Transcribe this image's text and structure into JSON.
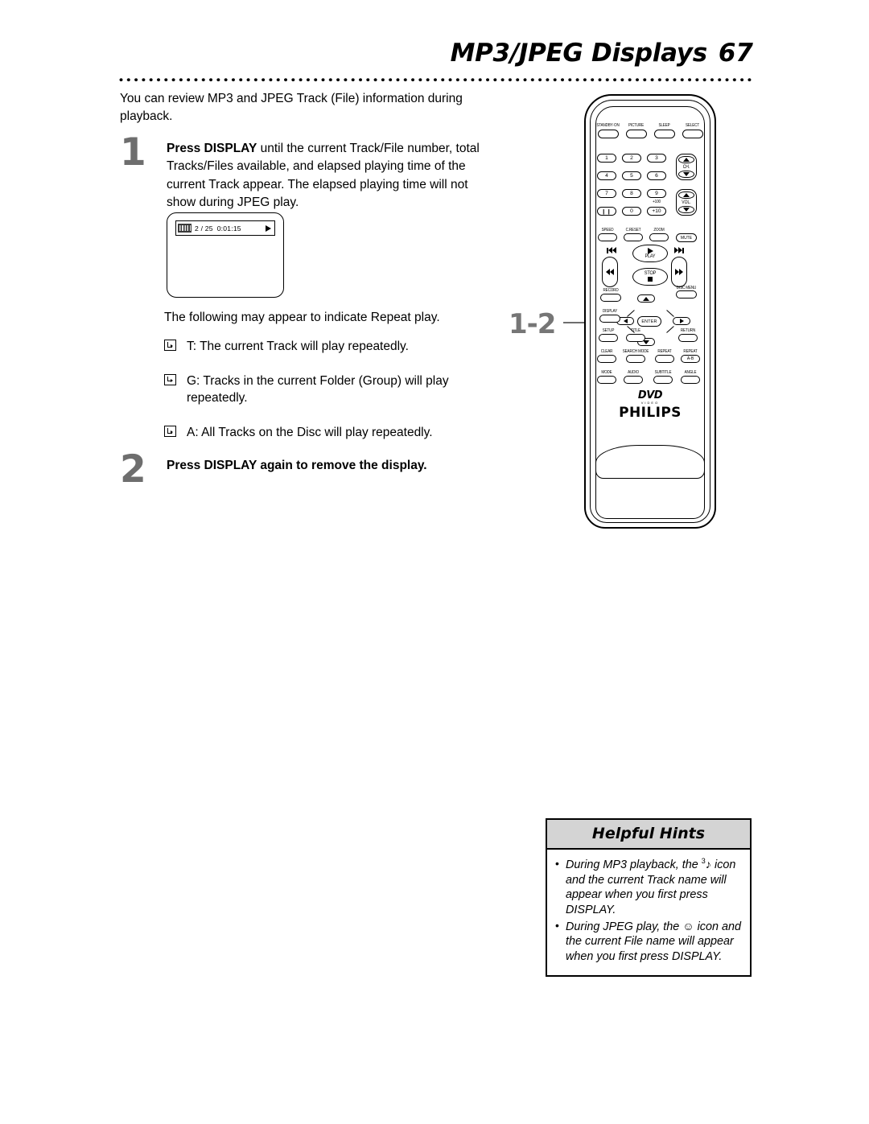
{
  "header": {
    "title": "MP3/JPEG Displays",
    "page_number": "67"
  },
  "intro": "You can review MP3 and  JPEG Track (File) information during playback.",
  "steps": [
    {
      "number": "1",
      "bold_lead": "Press DISPLAY",
      "rest": " until the current Track/File number, total Tracks/Files available, and elapsed playing time of the current Track appear. The elapsed playing time will not show during JPEG play."
    },
    {
      "number": "2",
      "text": "Press DISPLAY again to remove the display."
    }
  ],
  "osd": {
    "icon": "mp3-bars-icon",
    "track_current_total": "2 / 25",
    "elapsed_time": "0:01:15",
    "play_icon": "play-triangle-icon"
  },
  "repeat": {
    "intro": "The following may appear to indicate Repeat play.",
    "items": [
      "T: The current Track will play repeatedly.",
      "G: Tracks in the current Folder (Group) will play repeatedly.",
      "A: All Tracks on the Disc will play repeatedly."
    ]
  },
  "callout": {
    "label": "1-2"
  },
  "remote": {
    "brand": "PHILIPS",
    "logo_main": "DVD",
    "logo_sub": "VIDEO",
    "top_row": [
      "STANDBY·ON",
      "PICTURE",
      "SLEEP",
      "SELECT"
    ],
    "keypad": [
      [
        "1",
        "2",
        "3"
      ],
      [
        "4",
        "5",
        "6"
      ],
      [
        "7",
        "8",
        "9"
      ],
      [
        "❙❙",
        "0",
        "+10"
      ]
    ],
    "plus_hundred": "+100",
    "ch_label": "CH.",
    "vol_label": "VOL.",
    "mute_label": "MUTE",
    "fn_row_speed": [
      "SPEED",
      "C.RESET",
      "ZOOM"
    ],
    "transport": {
      "play": "PLAY",
      "stop": "STOP"
    },
    "record_label": "RECORD",
    "disc_menu_label": "DISC MENU",
    "display_label": "DISPLAY",
    "enter_label": "ENTER",
    "nav_row_setup": [
      "SETUP",
      "TITLE",
      "RETURN"
    ],
    "nav_row_clear": [
      "CLEAR",
      "SEARCH MODE",
      "REPEAT",
      "REPEAT"
    ],
    "repeat_ab_label": "A-B",
    "nav_row_mode": [
      "MODE",
      "AUDIO",
      "SUBTITLE",
      "ANGLE"
    ]
  },
  "hints": {
    "title": "Helpful Hints",
    "items": [
      {
        "before": "During MP3 playback, the ",
        "icon": "music-note-icon",
        "after": " icon and the current Track name will appear when you first press DISPLAY."
      },
      {
        "before": "During JPEG play, the ",
        "icon": "smiley-face-icon",
        "after": " icon and the current File name will appear when you first press DISPLAY."
      }
    ]
  }
}
